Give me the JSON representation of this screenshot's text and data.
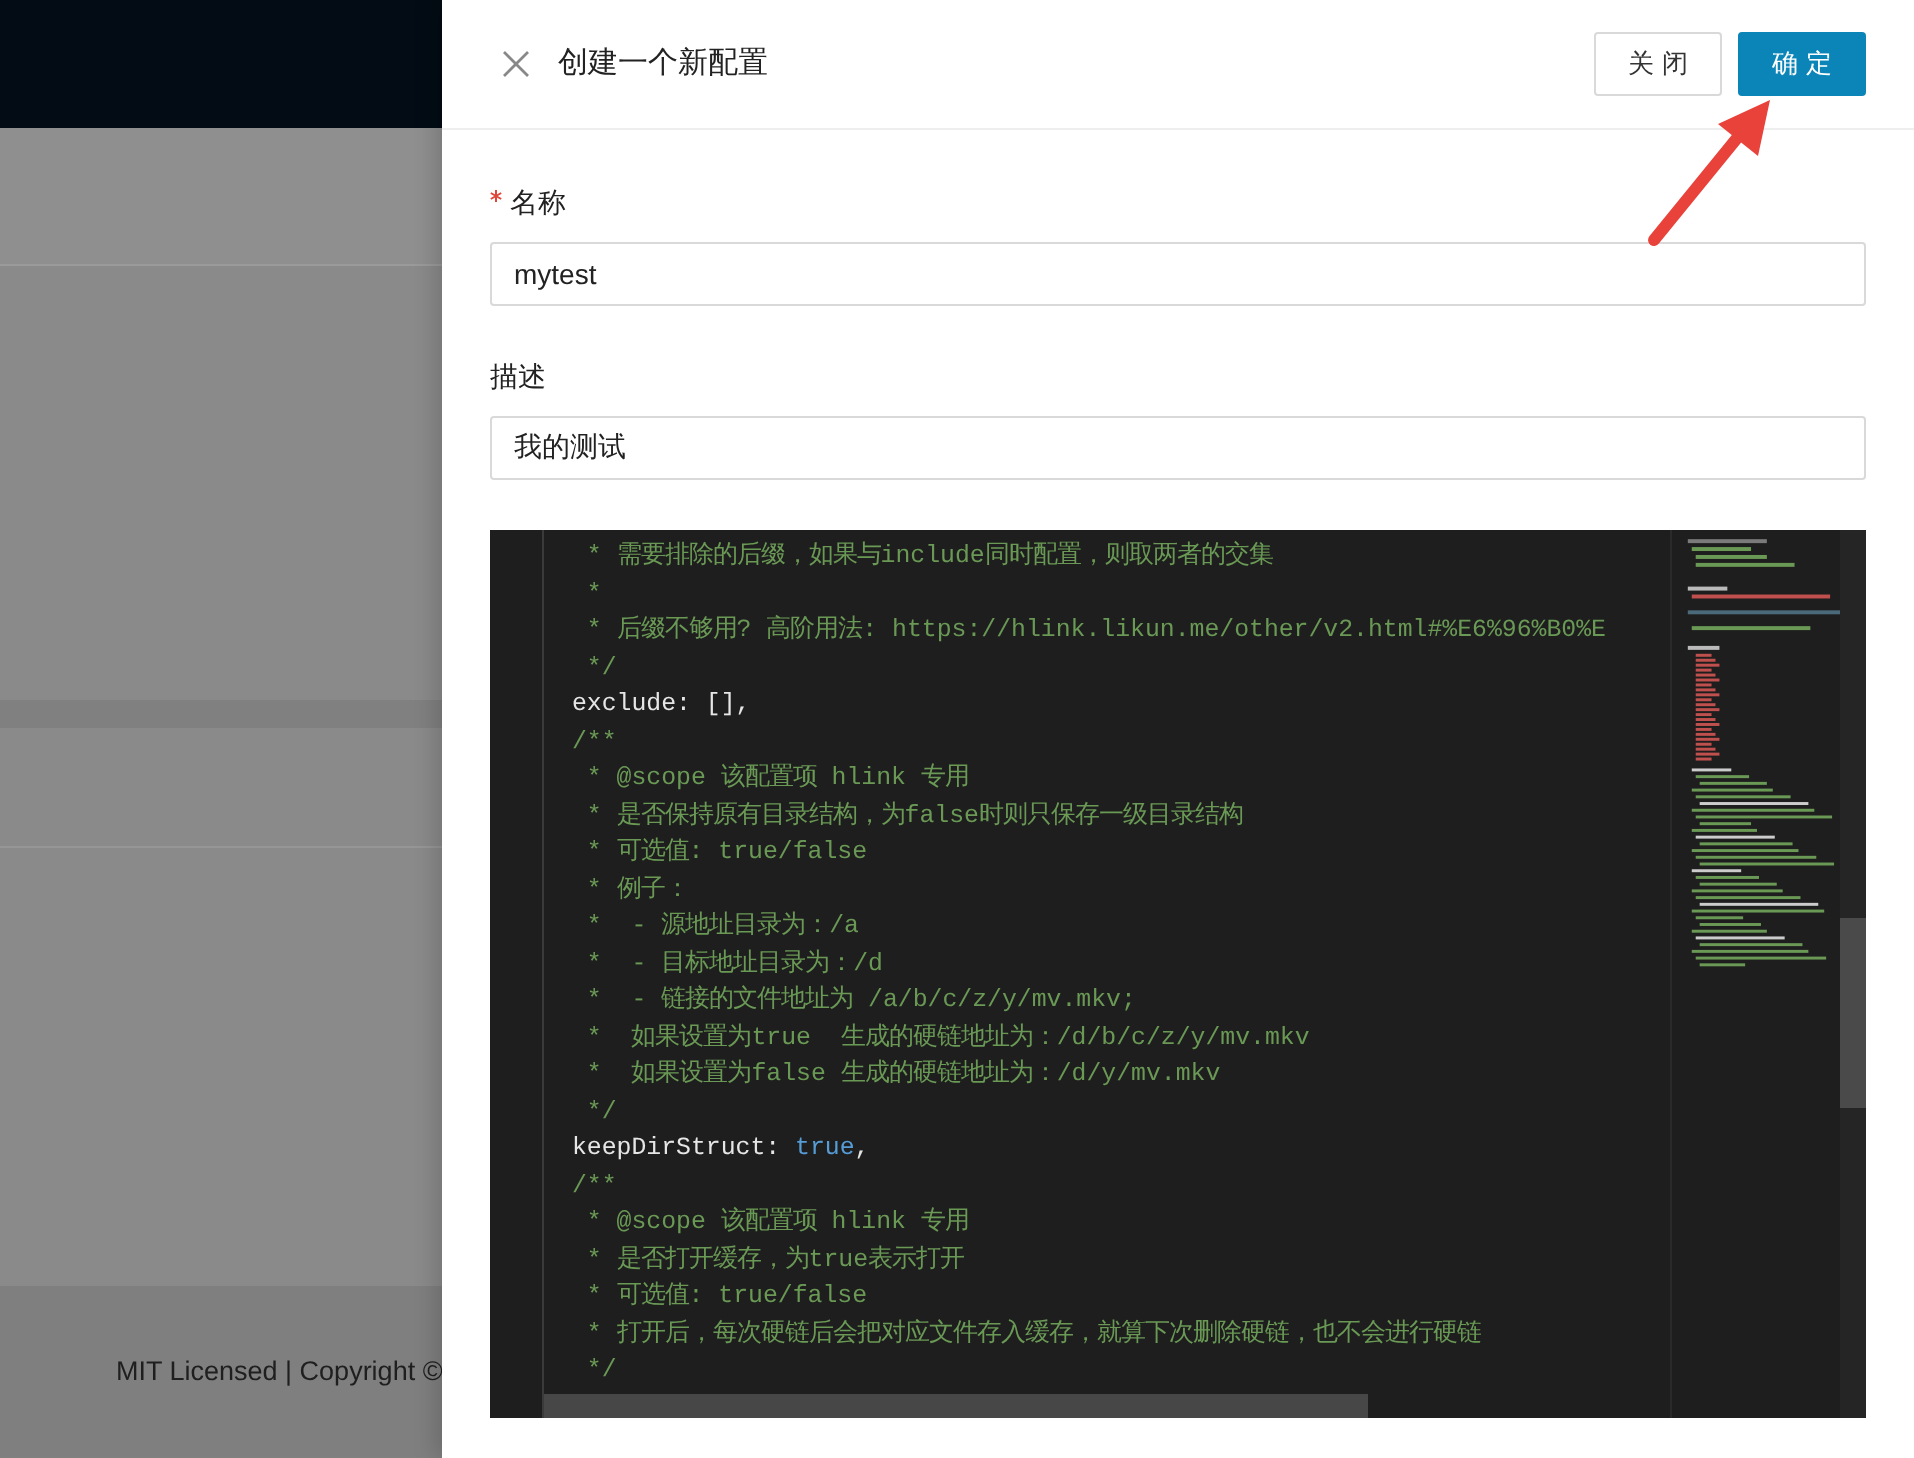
{
  "backdrop": {
    "footer": "MIT Licensed | Copyright ©"
  },
  "drawer": {
    "title": "创建一个新配置",
    "buttons": [
      {
        "label": "关闭",
        "kind": "default"
      },
      {
        "label": "确定",
        "kind": "primary"
      }
    ],
    "fields": [
      {
        "label": "名称",
        "required": true,
        "value": "mytest"
      },
      {
        "label": "描述",
        "required": false,
        "value": "我的测试"
      }
    ],
    "editor": {
      "lines": [
        {
          "parts": [
            {
              "kind": "comment",
              "text": " * 需要排除的后缀，如果与include同时配置，则取两者的交集"
            }
          ]
        },
        {
          "parts": [
            {
              "kind": "comment",
              "text": " *"
            }
          ]
        },
        {
          "parts": [
            {
              "kind": "comment",
              "text": " * 后缀不够用? 高阶用法: https://hlink.likun.me/other/v2.html#%E6%96%B0%E"
            }
          ]
        },
        {
          "parts": [
            {
              "kind": "comment",
              "text": " */"
            }
          ]
        },
        {
          "parts": [
            {
              "kind": "plain",
              "text": "exclude: [],"
            }
          ]
        },
        {
          "parts": [
            {
              "kind": "comment",
              "text": "/**"
            }
          ]
        },
        {
          "parts": [
            {
              "kind": "comment",
              "text": " * @scope 该配置项 hlink 专用"
            }
          ]
        },
        {
          "parts": [
            {
              "kind": "comment",
              "text": " * 是否保持原有目录结构，为false时则只保存一级目录结构"
            }
          ]
        },
        {
          "parts": [
            {
              "kind": "comment",
              "text": " * 可选值: true/false"
            }
          ]
        },
        {
          "parts": [
            {
              "kind": "comment",
              "text": " * 例子："
            }
          ]
        },
        {
          "parts": [
            {
              "kind": "comment",
              "text": " *  - 源地址目录为：/a"
            }
          ]
        },
        {
          "parts": [
            {
              "kind": "comment",
              "text": " *  - 目标地址目录为：/d"
            }
          ]
        },
        {
          "parts": [
            {
              "kind": "comment",
              "text": " *  - 链接的文件地址为 /a/b/c/z/y/mv.mkv;"
            }
          ]
        },
        {
          "parts": [
            {
              "kind": "comment",
              "text": " *  如果设置为true  生成的硬链地址为：/d/b/c/z/y/mv.mkv"
            }
          ]
        },
        {
          "parts": [
            {
              "kind": "comment",
              "text": " *  如果设置为false 生成的硬链地址为：/d/y/mv.mkv"
            }
          ]
        },
        {
          "parts": [
            {
              "kind": "comment",
              "text": " */"
            }
          ]
        },
        {
          "parts": [
            {
              "kind": "plain",
              "text": "keepDirStruct: "
            },
            {
              "kind": "keyword",
              "text": "true"
            },
            {
              "kind": "plain",
              "text": ","
            }
          ]
        },
        {
          "parts": [
            {
              "kind": "comment",
              "text": "/**"
            }
          ]
        },
        {
          "parts": [
            {
              "kind": "comment",
              "text": " * @scope 该配置项 hlink 专用"
            }
          ]
        },
        {
          "parts": [
            {
              "kind": "comment",
              "text": " * 是否打开缓存，为true表示打开"
            }
          ]
        },
        {
          "parts": [
            {
              "kind": "comment",
              "text": " * 可选值: true/false"
            }
          ]
        },
        {
          "parts": [
            {
              "kind": "comment",
              "text": " * 打开后，每次硬链后会把对应文件存入缓存，就算下次删除硬链，也不会进行硬链"
            }
          ]
        },
        {
          "parts": [
            {
              "kind": "comment",
              "text": " */"
            }
          ]
        }
      ]
    }
  }
}
